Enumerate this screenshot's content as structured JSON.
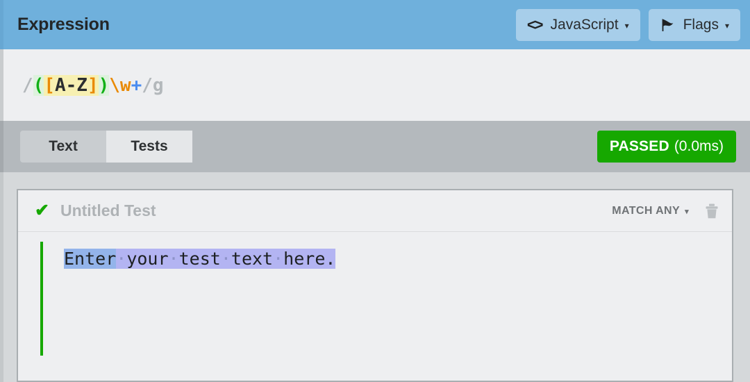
{
  "header": {
    "title": "Expression",
    "flavor_button": {
      "label": "JavaScript",
      "icon": "code-brackets-icon",
      "caret": "▾"
    },
    "flags_button": {
      "label": "Flags",
      "icon": "flag-icon",
      "caret": "▾"
    },
    "bg_color": "#6fb0dc",
    "button_bg_color": "#a7ceea"
  },
  "expression": {
    "full": "/([A-Z])\\w+/g",
    "tokens": [
      {
        "text": "/",
        "kind": "delimiter"
      },
      {
        "text": "(",
        "kind": "group-open"
      },
      {
        "text": "[",
        "kind": "set-bracket"
      },
      {
        "text": "A-Z",
        "kind": "set-content"
      },
      {
        "text": "]",
        "kind": "set-bracket"
      },
      {
        "text": ")",
        "kind": "group-close"
      },
      {
        "text": "\\w",
        "kind": "escape"
      },
      {
        "text": "+",
        "kind": "quantifier"
      },
      {
        "text": "/",
        "kind": "delimiter"
      },
      {
        "text": "g",
        "kind": "flags"
      }
    ],
    "colors": {
      "delimiter": "#b3b8bb",
      "group": "#11b016",
      "group_bg": "#ddf2dd",
      "set_bracket": "#e98a06",
      "set_bg": "#f7f0b2",
      "set_content": "#2b2e30",
      "escape": "#e98a06",
      "quantifier": "#4a8cf0"
    }
  },
  "tabs": {
    "items": [
      {
        "label": "Text",
        "active": false
      },
      {
        "label": "Tests",
        "active": true
      }
    ]
  },
  "status": {
    "label": "PASSED",
    "time": "(0.0ms)",
    "color": "#16a800"
  },
  "test": {
    "check_icon": "check-icon",
    "title": "Untitled Test",
    "match_mode": "MATCH ANY",
    "match_mode_caret": "▾",
    "delete_icon": "trash-icon",
    "pass_bar_color": "#16a800",
    "content": {
      "full_text": "Enter your test text here.",
      "space_glyph": "·",
      "segments": [
        {
          "text": "Enter",
          "style": "match"
        },
        {
          "text": " ",
          "style": "space"
        },
        {
          "text": "your",
          "style": "selected"
        },
        {
          "text": " ",
          "style": "space"
        },
        {
          "text": "test",
          "style": "selected"
        },
        {
          "text": " ",
          "style": "space"
        },
        {
          "text": "text",
          "style": "selected"
        },
        {
          "text": " ",
          "style": "space"
        },
        {
          "text": "here.",
          "style": "selected"
        }
      ],
      "match_highlight_color": "#93b4ea",
      "selection_color": "#b3b4f2"
    }
  }
}
